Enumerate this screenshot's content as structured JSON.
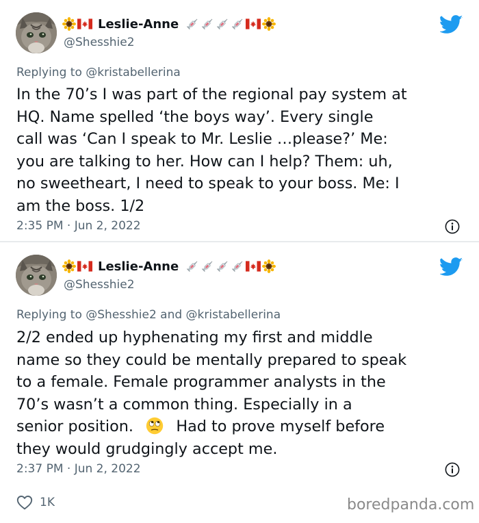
{
  "tweets": [
    {
      "name": "Leslie-Anne",
      "handle": "@Shesshie2",
      "reply_prefix": "Replying to",
      "reply_mentions": "@kristabellerina",
      "body_lines": [
        "In the 70’s I was part of the regional pay system at",
        "HQ.  Name spelled ‘the boys way’.  Every single",
        "call was ‘Can I speak to Mr. Leslie …please?’  Me:",
        "you are talking to her. How can I help?  Them: uh,",
        "no sweetheart, I need to speak to your boss.  Me: I",
        "am the boss.  1/2"
      ],
      "timestamp": "2:35 PM · Jun 2, 2022"
    },
    {
      "name": "Leslie-Anne",
      "handle": "@Shesshie2",
      "reply_prefix": "Replying to",
      "reply_mentions": "@Shesshie2 and @kristabellerina",
      "body_lines": [
        "2/2  ended up hyphenating my first and middle",
        "name so they could be mentally prepared to speak",
        "to a female.  Female programmer analysts in the",
        "70’s wasn’t a common thing.  Especially in a"
      ],
      "body_line5_before": "senior position.  ",
      "body_line5_after": "  Had to prove myself before",
      "body_line6": "they would grudgingly accept me.",
      "timestamp": "2:37 PM · Jun 2, 2022"
    }
  ],
  "likes": "1K",
  "watermark": "boredpanda.com",
  "icons": {
    "name_prefix": [
      "sunflower-icon",
      "canada-flag-icon"
    ],
    "name_suffix": [
      "syringe-icon",
      "syringe-icon",
      "syringe-icon",
      "syringe-icon",
      "canada-flag-icon",
      "sunflower-icon"
    ],
    "bird": "twitter-bird-icon",
    "info": "info-icon",
    "like": "heart-icon",
    "inline": "rolling-eyes-face-icon"
  },
  "colors": {
    "twitter_blue": "#1d9bf0",
    "text_primary": "#0f1419",
    "text_secondary": "#536471"
  }
}
